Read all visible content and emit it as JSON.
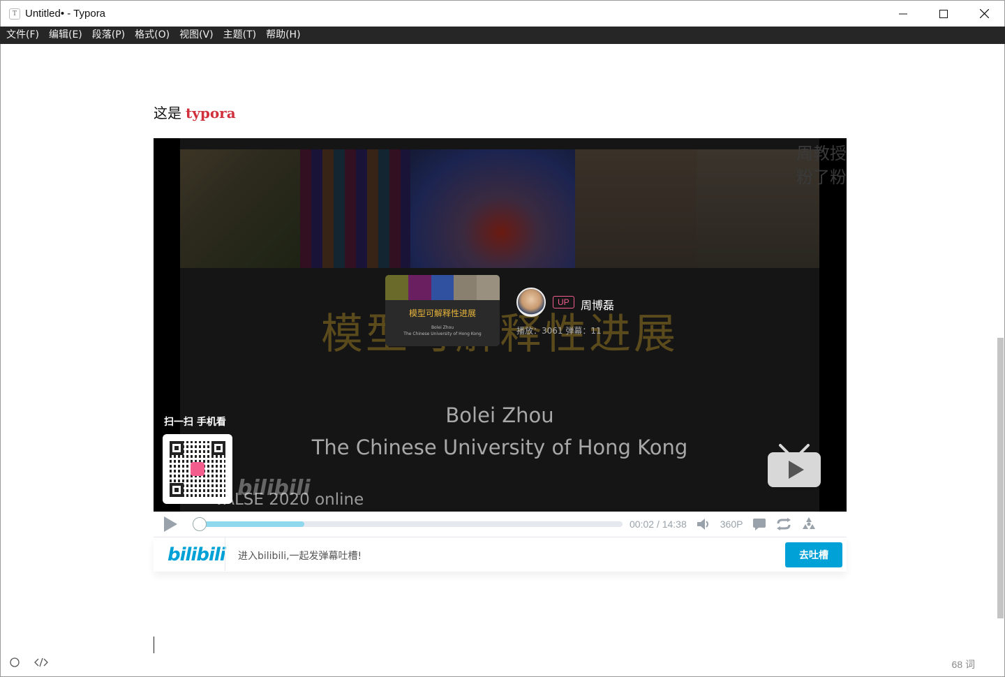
{
  "window": {
    "app_icon_letter": "T",
    "title": "Untitled• - Typora"
  },
  "menu": {
    "items": [
      {
        "label": "文件(F)"
      },
      {
        "label": "编辑(E)"
      },
      {
        "label": "段落(P)"
      },
      {
        "label": "格式(O)"
      },
      {
        "label": "视图(V)"
      },
      {
        "label": "主题(T)"
      },
      {
        "label": "帮助(H)"
      }
    ]
  },
  "document": {
    "paragraph_prefix": "这是",
    "paragraph_highlight": "typora"
  },
  "video": {
    "slide_title": "模型可解释性进展",
    "slide_author": "Bolei Zhou",
    "slide_affiliation": "The Chinese University of Hong Kong",
    "slide_conference": "VALSE 2020 online",
    "corner_text_line1": "周教授",
    "corner_text_line2": "粉了粉",
    "card_title": "模型可解释性进展",
    "card_sub_line1": "Bolei Zhou",
    "card_sub_line2": "The Chinese University of Hong Kong",
    "up_badge": "UP",
    "up_name": "周博磊",
    "up_stats": "播放：3061    弹幕：11",
    "qr_label": "扫一扫 手机看",
    "watermark": "bilibili",
    "colors": {
      "accent": "#00a1d6",
      "up_pink": "#f25d8e",
      "card_title": "#e7b43b"
    }
  },
  "controls": {
    "current_time": "00:02",
    "separator": "/",
    "total_time": "14:38",
    "quality": "360P",
    "buffered_fraction": 0.26,
    "played_fraction": 0.002,
    "icons": [
      "play-icon",
      "volume-icon",
      "danmaku-toggle-icon",
      "loop-icon",
      "widescreen-icon"
    ]
  },
  "danmaku": {
    "logo": "bilibili",
    "placeholder": "进入bilibili,一起发弹幕吐槽!",
    "send_label": "去吐槽"
  },
  "statusbar": {
    "word_count": "68 词"
  }
}
